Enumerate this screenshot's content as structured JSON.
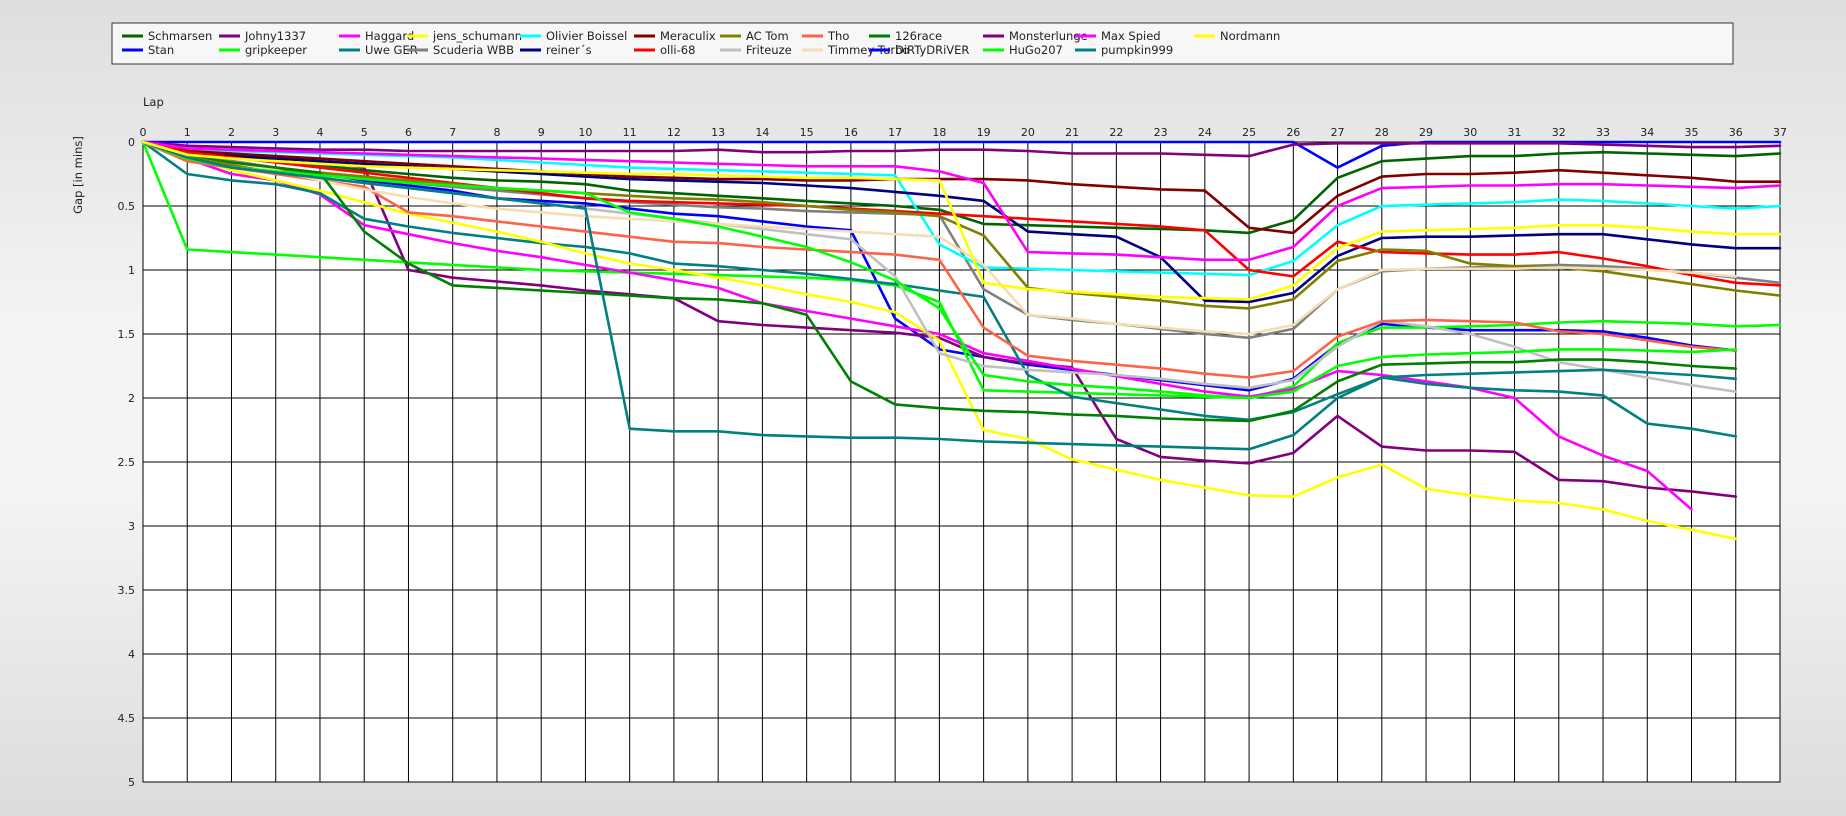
{
  "chart_data": {
    "type": "line",
    "xlabel": "Lap",
    "ylabel": "Gap [in mins]",
    "xlim": [
      0,
      37
    ],
    "ylim": [
      0,
      5
    ],
    "y_inverted": true,
    "x_ticks": [
      0,
      1,
      2,
      3,
      4,
      5,
      6,
      7,
      8,
      9,
      10,
      11,
      12,
      13,
      14,
      15,
      16,
      17,
      18,
      19,
      20,
      21,
      22,
      23,
      24,
      25,
      26,
      27,
      28,
      29,
      30,
      31,
      32,
      33,
      34,
      35,
      36,
      37
    ],
    "y_ticks": [
      0,
      0.5,
      1,
      1.5,
      2,
      2.5,
      3,
      3.5,
      4,
      4.5,
      5
    ],
    "y_tick_labels": [
      "0",
      "0.5",
      "1",
      "1.5",
      "2",
      "2.5",
      "3",
      "3.5",
      "4",
      "4.5",
      "5"
    ],
    "grid": true,
    "legend_position": "top",
    "series": [
      {
        "name": "Schmarsen",
        "color": "#006400",
        "values": [
          0,
          0.09,
          0.12,
          0.15,
          0.18,
          0.22,
          0.25,
          0.28,
          0.3,
          0.31,
          0.33,
          0.38,
          0.4,
          0.42,
          0.44,
          0.46,
          0.48,
          0.5,
          0.53,
          0.64,
          0.65,
          0.66,
          0.67,
          0.68,
          0.69,
          0.71,
          0.61,
          0.28,
          0.15,
          0.13,
          0.11,
          0.11,
          0.09,
          0.08,
          0.09,
          0.1,
          0.11,
          0.09
        ]
      },
      {
        "name": "Stan",
        "color": "#0000ff",
        "values": [
          0,
          0.1,
          0.15,
          0.2,
          0.25,
          0.3,
          0.34,
          0.38,
          0.44,
          0.46,
          0.48,
          0.52,
          0.56,
          0.58,
          0.62,
          0.66,
          0.69,
          1.38,
          1.62,
          1.68,
          1.74,
          1.78,
          1.82,
          1.86,
          1.9,
          1.94,
          1.85,
          1.58,
          1.42,
          1.45,
          1.47,
          1.47,
          1.47,
          1.48,
          1.53,
          1.59,
          1.63
        ]
      },
      {
        "name": "Johny1337",
        "color": "#800080",
        "values": [
          0,
          0.08,
          0.1,
          0.12,
          0.15,
          0.2,
          1.0,
          1.06,
          1.09,
          1.12,
          1.16,
          1.19,
          1.22,
          1.4,
          1.43,
          1.45,
          1.47,
          1.49,
          1.53,
          1.68,
          1.73,
          1.76,
          2.32,
          2.46,
          2.49,
          2.51,
          2.43,
          2.14,
          2.38,
          2.41,
          2.41,
          2.42,
          2.64,
          2.65,
          2.7,
          2.73,
          2.77
        ]
      },
      {
        "name": "gripkeeper",
        "color": "#00ff00",
        "values": [
          0,
          0.84,
          0.86,
          0.88,
          0.9,
          0.92,
          0.94,
          0.96,
          0.98,
          1.0,
          1.01,
          1.02,
          1.03,
          1.04,
          1.05,
          1.06,
          1.08,
          1.12,
          1.25,
          1.94,
          1.95,
          1.96,
          1.97,
          1.98,
          1.99,
          2.0,
          1.91,
          1.57,
          1.45,
          1.45,
          1.44,
          1.43,
          1.41,
          1.4,
          1.41,
          1.42,
          1.44,
          1.43
        ]
      },
      {
        "name": "Haggard",
        "color": "#ff00ff",
        "values": [
          0,
          0.13,
          0.25,
          0.3,
          0.41,
          0.65,
          0.72,
          0.79,
          0.85,
          0.9,
          0.96,
          1.02,
          1.08,
          1.14,
          1.26,
          1.32,
          1.38,
          1.44,
          1.5,
          1.65,
          1.71,
          1.77,
          1.83,
          1.89,
          1.95,
          1.99,
          1.93,
          1.79,
          1.82,
          1.87,
          1.92,
          2.0,
          2.3,
          2.45,
          2.57,
          2.87
        ]
      },
      {
        "name": "Uwe GER",
        "color": "#008080",
        "values": [
          0,
          0.25,
          0.3,
          0.33,
          0.4,
          0.6,
          0.66,
          0.71,
          0.75,
          0.79,
          0.82,
          0.87,
          0.95,
          0.97,
          1.0,
          1.03,
          1.07,
          1.11,
          1.16,
          1.21,
          1.82,
          1.99,
          2.04,
          2.09,
          2.14,
          2.17,
          2.11,
          1.97,
          1.84,
          1.89,
          1.92,
          1.94,
          1.95,
          1.98,
          2.2,
          2.24,
          2.3
        ]
      },
      {
        "name": "jens_schumann",
        "color": "#ffff00",
        "values": [
          0,
          0.12,
          0.22,
          0.3,
          0.38,
          0.47,
          0.56,
          0.63,
          0.7,
          0.78,
          0.87,
          0.95,
          1.0,
          1.06,
          1.12,
          1.19,
          1.25,
          1.33,
          1.55,
          2.25,
          2.32,
          2.48,
          2.56,
          2.64,
          2.7,
          2.76,
          2.77,
          2.62,
          2.52,
          2.71,
          2.76,
          2.8,
          2.82,
          2.87,
          2.96,
          3.03,
          3.1
        ]
      },
      {
        "name": "Scuderia WBB",
        "color": "#808080",
        "values": [
          0,
          0.1,
          0.15,
          0.2,
          0.24,
          0.28,
          0.32,
          0.35,
          0.38,
          0.41,
          0.44,
          0.47,
          0.49,
          0.51,
          0.52,
          0.54,
          0.55,
          0.56,
          0.57,
          1.15,
          1.35,
          1.39,
          1.42,
          1.46,
          1.5,
          1.53,
          1.46,
          1.15,
          1.01,
          0.99,
          0.98,
          0.97,
          0.96,
          0.97,
          0.99,
          1.02,
          1.06,
          1.1
        ]
      },
      {
        "name": "Olivier Boissel",
        "color": "#00ffff",
        "values": [
          0,
          0.06,
          0.07,
          0.08,
          0.09,
          0.1,
          0.11,
          0.12,
          0.14,
          0.16,
          0.18,
          0.2,
          0.21,
          0.22,
          0.23,
          0.24,
          0.25,
          0.26,
          0.8,
          0.98,
          0.99,
          1.0,
          1.01,
          1.02,
          1.03,
          1.04,
          0.93,
          0.65,
          0.5,
          0.49,
          0.48,
          0.47,
          0.45,
          0.46,
          0.48,
          0.5,
          0.52,
          0.5
        ]
      },
      {
        "name": "reiner´s",
        "color": "#000080",
        "values": [
          0,
          0.09,
          0.11,
          0.13,
          0.15,
          0.17,
          0.19,
          0.21,
          0.23,
          0.25,
          0.27,
          0.29,
          0.3,
          0.31,
          0.32,
          0.34,
          0.36,
          0.39,
          0.42,
          0.46,
          0.7,
          0.72,
          0.74,
          0.9,
          1.24,
          1.25,
          1.18,
          0.89,
          0.75,
          0.74,
          0.74,
          0.73,
          0.72,
          0.72,
          0.76,
          0.8,
          0.83,
          0.83
        ]
      },
      {
        "name": "Meraculix",
        "color": "#800000",
        "values": [
          0,
          0.07,
          0.09,
          0.11,
          0.13,
          0.15,
          0.17,
          0.19,
          0.21,
          0.23,
          0.25,
          0.27,
          0.28,
          0.29,
          0.29,
          0.3,
          0.3,
          0.29,
          0.29,
          0.29,
          0.3,
          0.33,
          0.35,
          0.37,
          0.38,
          0.67,
          0.71,
          0.42,
          0.27,
          0.25,
          0.25,
          0.24,
          0.22,
          0.24,
          0.26,
          0.28,
          0.31,
          0.31
        ]
      },
      {
        "name": "olli-68",
        "color": "#ff0000",
        "values": [
          0,
          0.08,
          0.12,
          0.16,
          0.2,
          0.24,
          0.28,
          0.32,
          0.36,
          0.4,
          0.44,
          0.46,
          0.47,
          0.48,
          0.49,
          0.5,
          0.52,
          0.54,
          0.56,
          0.58,
          0.6,
          0.62,
          0.64,
          0.66,
          0.69,
          1.0,
          1.05,
          0.78,
          0.86,
          0.87,
          0.88,
          0.88,
          0.86,
          0.91,
          0.97,
          1.04,
          1.1,
          1.12
        ]
      },
      {
        "name": "AC Tom",
        "color": "#808000",
        "values": [
          0,
          0.12,
          0.18,
          0.21,
          0.24,
          0.27,
          0.3,
          0.33,
          0.36,
          0.38,
          0.4,
          0.42,
          0.44,
          0.45,
          0.47,
          0.5,
          0.53,
          0.55,
          0.58,
          0.73,
          1.14,
          1.18,
          1.21,
          1.24,
          1.28,
          1.3,
          1.23,
          0.93,
          0.84,
          0.85,
          0.95,
          0.97,
          0.98,
          1.01,
          1.06,
          1.11,
          1.16,
          1.2
        ]
      },
      {
        "name": "Friteuze",
        "color": "#c0c0c0",
        "values": [
          0,
          0.15,
          0.2,
          0.24,
          0.28,
          0.32,
          0.36,
          0.4,
          0.44,
          0.48,
          0.52,
          0.56,
          0.6,
          0.64,
          0.68,
          0.72,
          0.76,
          1.05,
          1.65,
          1.75,
          1.78,
          1.8,
          1.82,
          1.85,
          1.89,
          1.92,
          1.86,
          1.6,
          1.4,
          1.44,
          1.5,
          1.6,
          1.72,
          1.78,
          1.84,
          1.9,
          1.95
        ]
      },
      {
        "name": "Tho",
        "color": "#ff6347",
        "values": [
          0,
          0.15,
          0.2,
          0.25,
          0.3,
          0.35,
          0.55,
          0.58,
          0.62,
          0.66,
          0.7,
          0.74,
          0.78,
          0.79,
          0.82,
          0.84,
          0.86,
          0.88,
          0.92,
          1.45,
          1.67,
          1.71,
          1.74,
          1.77,
          1.81,
          1.84,
          1.79,
          1.52,
          1.4,
          1.39,
          1.4,
          1.41,
          1.48,
          1.5,
          1.55,
          1.6,
          1.63
        ]
      },
      {
        "name": "Timmey Turbo",
        "color": "#f5deb3",
        "values": [
          0,
          0.1,
          0.16,
          0.22,
          0.3,
          0.37,
          0.43,
          0.48,
          0.52,
          0.55,
          0.58,
          0.6,
          0.62,
          0.64,
          0.66,
          0.68,
          0.7,
          0.72,
          0.74,
          0.96,
          1.35,
          1.38,
          1.42,
          1.45,
          1.48,
          1.5,
          1.43,
          1.15,
          1.0,
          0.99,
          0.99,
          0.99,
          0.98,
          0.99,
          1.0,
          1.02,
          1.05
        ]
      },
      {
        "name": "126race",
        "color": "#008000",
        "values": [
          0,
          0.1,
          0.16,
          0.2,
          0.24,
          0.7,
          0.95,
          1.12,
          1.14,
          1.16,
          1.18,
          1.2,
          1.22,
          1.23,
          1.26,
          1.35,
          1.87,
          2.05,
          2.08,
          2.1,
          2.11,
          2.13,
          2.14,
          2.16,
          2.17,
          2.18,
          2.1,
          1.87,
          1.74,
          1.73,
          1.72,
          1.72,
          1.7,
          1.7,
          1.72,
          1.75,
          1.77
        ]
      },
      {
        "name": "DiRTyDRiVER",
        "color": "#0000ff",
        "values": [
          0,
          0,
          0,
          0,
          0,
          0,
          0,
          0,
          0,
          0,
          0,
          0,
          0,
          0,
          0,
          0,
          0,
          0,
          0,
          0,
          0,
          0,
          0,
          0,
          0,
          0,
          0,
          0.2,
          0.03,
          0,
          0,
          0,
          0,
          0,
          0,
          0,
          0,
          0
        ]
      },
      {
        "name": "Monsterlunge",
        "color": "#800080",
        "values": [
          0,
          0.03,
          0.04,
          0.05,
          0.06,
          0.06,
          0.07,
          0.07,
          0.07,
          0.07,
          0.07,
          0.07,
          0.07,
          0.06,
          0.08,
          0.08,
          0.07,
          0.07,
          0.06,
          0.06,
          0.07,
          0.09,
          0.09,
          0.09,
          0.1,
          0.11,
          0.02,
          0.01,
          0.01,
          0.01,
          0.01,
          0.01,
          0.01,
          0.02,
          0.03,
          0.04,
          0.04,
          0.03
        ]
      },
      {
        "name": "HuGo207",
        "color": "#00ff00",
        "values": [
          0,
          0.13,
          0.2,
          0.23,
          0.26,
          0.29,
          0.32,
          0.34,
          0.36,
          0.38,
          0.4,
          0.55,
          0.6,
          0.66,
          0.74,
          0.82,
          0.94,
          1.08,
          1.3,
          1.82,
          1.87,
          1.9,
          1.92,
          1.95,
          1.98,
          2.0,
          1.95,
          1.75,
          1.68,
          1.66,
          1.65,
          1.64,
          1.62,
          1.62,
          1.63,
          1.64,
          1.62
        ]
      },
      {
        "name": "Max Spied",
        "color": "#ff00ff",
        "values": [
          0,
          0.05,
          0.06,
          0.07,
          0.08,
          0.09,
          0.1,
          0.11,
          0.12,
          0.13,
          0.14,
          0.15,
          0.16,
          0.17,
          0.18,
          0.19,
          0.19,
          0.19,
          0.23,
          0.32,
          0.86,
          0.87,
          0.88,
          0.9,
          0.92,
          0.92,
          0.82,
          0.5,
          0.36,
          0.35,
          0.34,
          0.34,
          0.33,
          0.33,
          0.34,
          0.35,
          0.36,
          0.34
        ]
      },
      {
        "name": "pumpkin999",
        "color": "#008080",
        "values": [
          0,
          0.12,
          0.2,
          0.24,
          0.28,
          0.32,
          0.36,
          0.4,
          0.44,
          0.48,
          0.52,
          2.24,
          2.26,
          2.26,
          2.29,
          2.3,
          2.31,
          2.31,
          2.32,
          2.34,
          2.35,
          2.36,
          2.37,
          2.38,
          2.39,
          2.4,
          2.29,
          2.0,
          1.84,
          1.82,
          1.81,
          1.8,
          1.79,
          1.78,
          1.8,
          1.82,
          1.85
        ]
      },
      {
        "name": "Nordmann",
        "color": "#ffff00",
        "values": [
          0,
          0.1,
          0.13,
          0.15,
          0.17,
          0.19,
          0.2,
          0.21,
          0.22,
          0.23,
          0.24,
          0.25,
          0.25,
          0.26,
          0.27,
          0.28,
          0.28,
          0.29,
          0.3,
          1.1,
          1.15,
          1.17,
          1.19,
          1.21,
          1.22,
          1.23,
          1.12,
          0.83,
          0.7,
          0.69,
          0.68,
          0.67,
          0.65,
          0.65,
          0.67,
          0.7,
          0.72,
          0.72
        ]
      }
    ]
  }
}
